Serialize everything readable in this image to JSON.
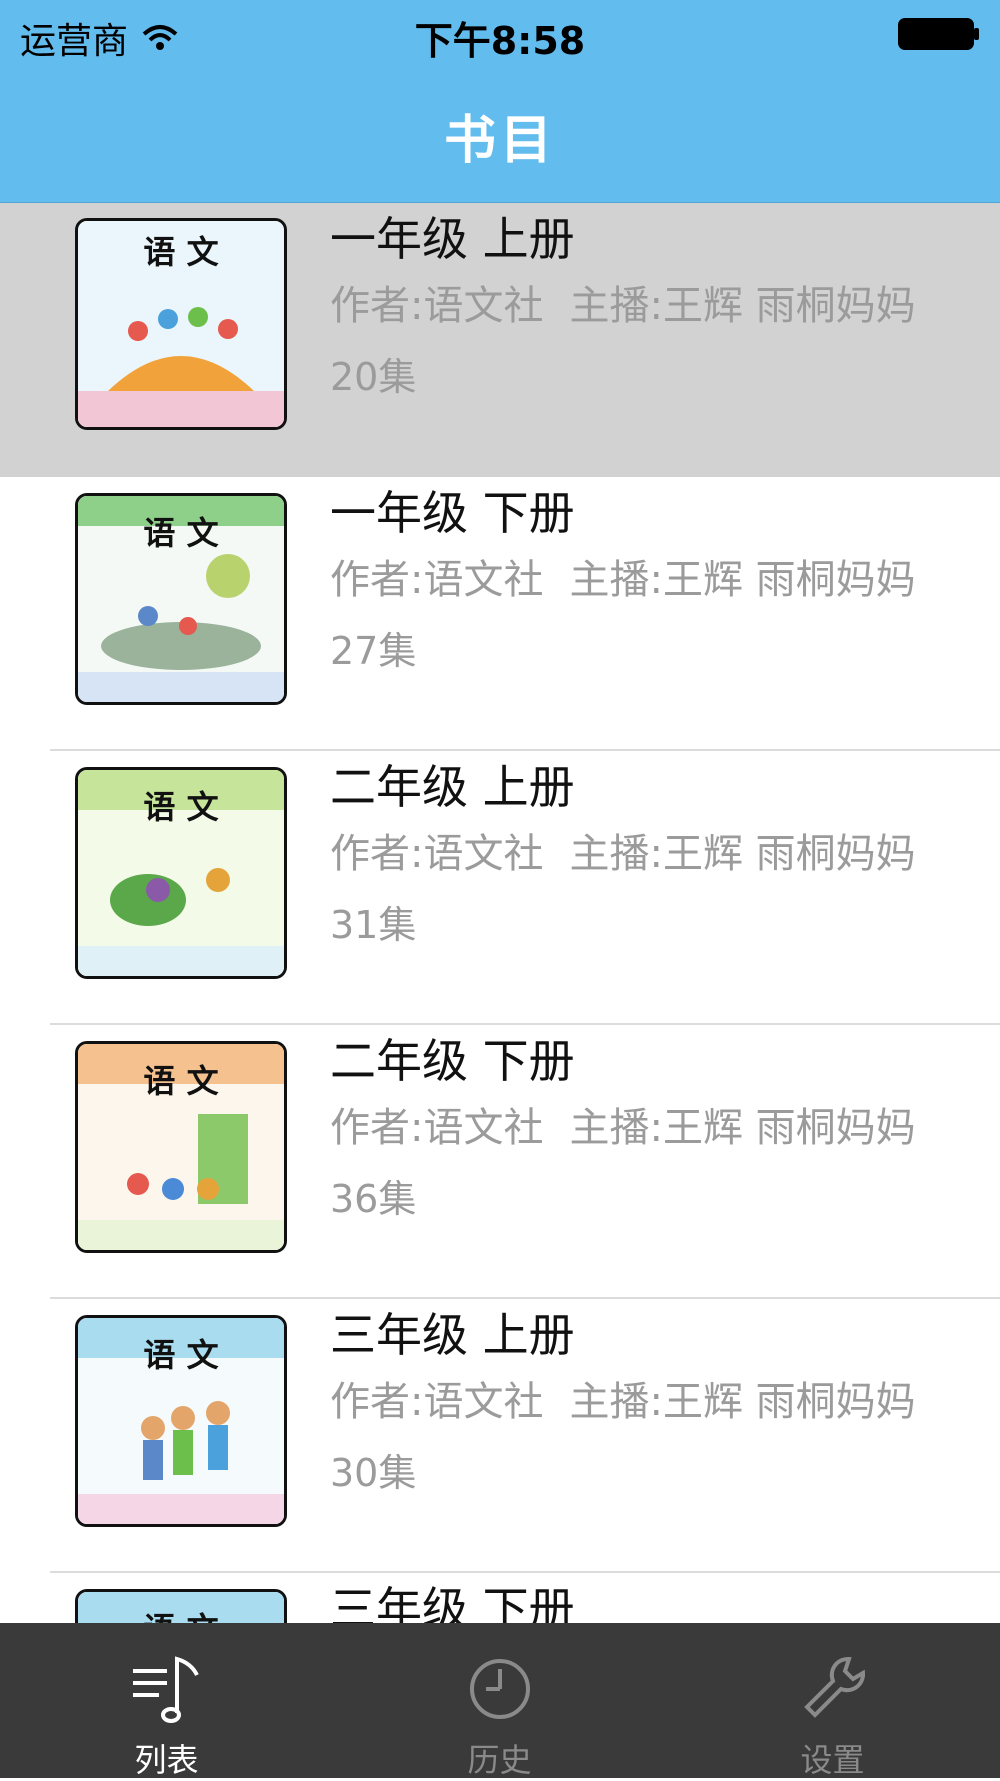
{
  "status_bar": {
    "carrier": "运营商",
    "time": "下午8:58"
  },
  "nav": {
    "title": "书目"
  },
  "books": [
    {
      "title": "一年级 上册",
      "author": "作者:语文社",
      "host": "主播:王辉 雨桐妈妈",
      "episodes": "20集",
      "cover_title": "语 文",
      "cover_accent": "#f3c6d6"
    },
    {
      "title": "一年级 下册",
      "author": "作者:语文社",
      "host": "主播:王辉 雨桐妈妈",
      "episodes": "27集",
      "cover_title": "语 文",
      "cover_accent": "#8ed08a"
    },
    {
      "title": "二年级 上册",
      "author": "作者:语文社",
      "host": "主播:王辉 雨桐妈妈",
      "episodes": "31集",
      "cover_title": "语 文",
      "cover_accent": "#c6e59a"
    },
    {
      "title": "二年级 下册",
      "author": "作者:语文社",
      "host": "主播:王辉 雨桐妈妈",
      "episodes": "36集",
      "cover_title": "语 文",
      "cover_accent": "#f5c18e"
    },
    {
      "title": "三年级 上册",
      "author": "作者:语文社",
      "host": "主播:王辉 雨桐妈妈",
      "episodes": "30集",
      "cover_title": "语 文",
      "cover_accent": "#a9dcef"
    },
    {
      "title": "三年级 下册",
      "author": "",
      "host": "",
      "episodes": "",
      "cover_title": "语 文",
      "cover_accent": "#a9dcef"
    }
  ],
  "tabs": [
    {
      "label": "列表",
      "icon": "music-list-icon",
      "active": true
    },
    {
      "label": "历史",
      "icon": "clock-icon",
      "active": false
    },
    {
      "label": "设置",
      "icon": "wrench-icon",
      "active": false
    }
  ],
  "colors": {
    "nav_bg": "#63bcee",
    "tab_bg": "#3a3a3a",
    "selected_row": "#d2d2d2"
  }
}
